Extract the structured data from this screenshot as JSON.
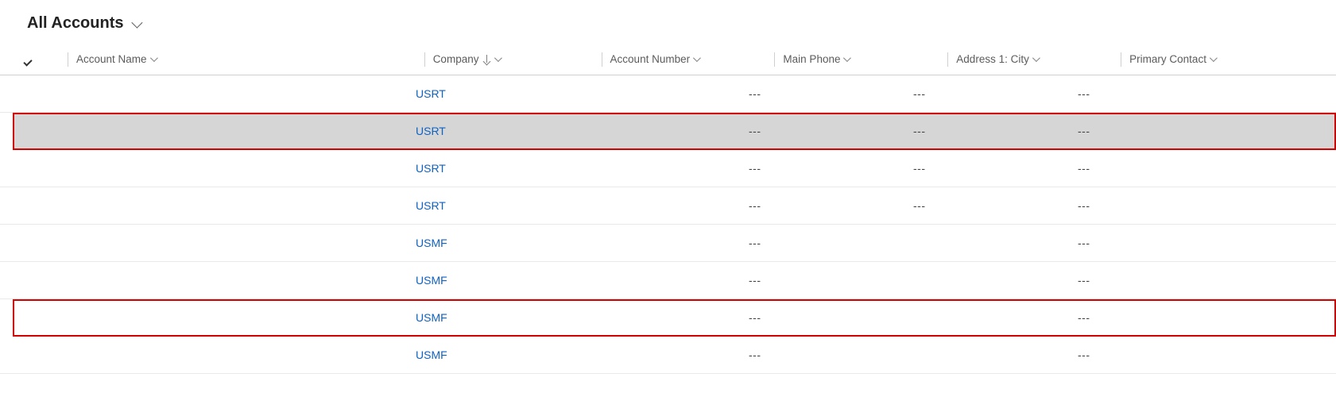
{
  "header": {
    "title": "All Accounts"
  },
  "columns": {
    "account_name": "Account Name",
    "company": "Company",
    "account_number": "Account Number",
    "main_phone": "Main Phone",
    "address_city": "Address 1: City",
    "primary_contact": "Primary Contact"
  },
  "rows": [
    {
      "account_name": "",
      "company": "USRT",
      "account_number": "",
      "main_phone": "---",
      "address_city": "---",
      "primary_contact": "---",
      "variant": "normal"
    },
    {
      "account_name": "",
      "company": "USRT",
      "account_number": "",
      "main_phone": "---",
      "address_city": "---",
      "primary_contact": "---",
      "variant": "highlighted"
    },
    {
      "account_name": "",
      "company": "USRT",
      "account_number": "",
      "main_phone": "---",
      "address_city": "---",
      "primary_contact": "---",
      "variant": "normal"
    },
    {
      "account_name": "",
      "company": "USRT",
      "account_number": "",
      "main_phone": "---",
      "address_city": "---",
      "primary_contact": "---",
      "variant": "normal"
    },
    {
      "account_name": "",
      "company": "USMF",
      "account_number": "",
      "main_phone": "---",
      "address_city": "",
      "primary_contact": "---",
      "variant": "normal"
    },
    {
      "account_name": "",
      "company": "USMF",
      "account_number": "",
      "main_phone": "---",
      "address_city": "",
      "primary_contact": "---",
      "variant": "normal"
    },
    {
      "account_name": "",
      "company": "USMF",
      "account_number": "",
      "main_phone": "---",
      "address_city": "",
      "primary_contact": "---",
      "variant": "redbox"
    },
    {
      "account_name": "",
      "company": "USMF",
      "account_number": "",
      "main_phone": "---",
      "address_city": "",
      "primary_contact": "---",
      "variant": "normal"
    }
  ]
}
